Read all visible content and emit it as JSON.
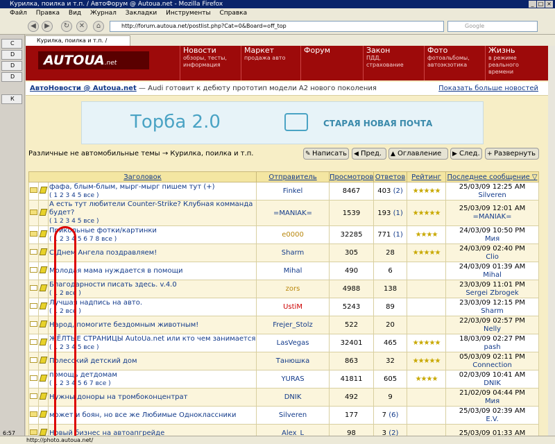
{
  "window": {
    "title": "Курилка, поилка и т.п. / АвтоФорум @ Autoua.net - Mozilla Firefox"
  },
  "menu": [
    "Файл",
    "Правка",
    "Вид",
    "Журнал",
    "Закладки",
    "Инструменты",
    "Справка"
  ],
  "url": "http://forum.autoua.net/postlist.php?Cat=0&Board=off_top",
  "search_placeholder": "Google",
  "tab_title": "Курилка, поилка и т.п. / АвтоФо...",
  "sidebar_items": [
    "C",
    "D",
    "D",
    "D",
    "К"
  ],
  "status_url": "http://photo.autoua.net/",
  "clock": "6:57",
  "logo": {
    "main": "AUTOUA",
    "suffix": ".net"
  },
  "header_nav": [
    {
      "title": "Новости",
      "sub": "обзоры, тесты, информация"
    },
    {
      "title": "Маркет",
      "sub": "продажа авто"
    },
    {
      "title": "Форум",
      "sub": ""
    },
    {
      "title": "Закон",
      "sub": "ПДД, страхование"
    },
    {
      "title": "Фото",
      "sub": "фотоальбомы, автоэкзотика"
    },
    {
      "title": "Жизнь",
      "sub": "в режиме реального времени"
    }
  ],
  "news": {
    "source": "АвтоНовости @ Autoua.net",
    "text": "— Audi готовит к дебюту прототип модели A2 нового поколения",
    "more": "Показать больше новостей"
  },
  "banner": {
    "left": "Торба 2.0",
    "right": "СТАРАЯ НОВАЯ ПОЧТА"
  },
  "breadcrumb": "Различные не автомобильные темы → Курилка, поилка и т.п.",
  "buttons": {
    "write": "Написать",
    "prev": "Пред.",
    "toc": "Оглавление",
    "next": "След.",
    "expand": "Развернуть"
  },
  "columns": [
    "Заголовок",
    "Отправитель",
    "Просмотров",
    "Ответов",
    "Рейтинг",
    "Последнее сообщение ▽"
  ],
  "rows": [
    {
      "subject": "фафа, блым-блым, мырг-мырг пишем тут (+)",
      "pages": "( 1 2 3 4 5 все )",
      "sender": "Finkel",
      "views": "8467",
      "replies": "403",
      "new": "(2)",
      "rating": "★★★★★",
      "last_date": "25/03/09 12:25 AM",
      "last_user": "Silveren"
    },
    {
      "subject": "А есть тут любители Counter-Strike? Клубная комманда будет?",
      "pages": "( 1 2 3 4 5 все )",
      "sender": "=MANIAK=",
      "views": "1539",
      "replies": "193",
      "new": "(1)",
      "rating": "★★★★★",
      "last_date": "25/03/09 12:01 AM",
      "last_user": "=MANIAK="
    },
    {
      "subject": "Прикольные фотки/картинки",
      "pages": "( 1 2 3 4 5 6 7 8 все )",
      "sender": "e0000",
      "views": "32285",
      "replies": "771",
      "new": "(1)",
      "rating": "★★★★",
      "last_date": "24/03/09 10:50 PM",
      "last_user": "Мия"
    },
    {
      "subject": "С Днем Ангела поздравляем!",
      "pages": "",
      "sender": "Sharm",
      "views": "305",
      "replies": "28",
      "new": "",
      "rating": "★★★★★",
      "last_date": "24/03/09 02:40 PM",
      "last_user": "Clio"
    },
    {
      "subject": "Молодая мама нуждается в помощи",
      "pages": "",
      "sender": "Mihal",
      "views": "490",
      "replies": "6",
      "new": "",
      "rating": "",
      "last_date": "24/03/09 01:39 AM",
      "last_user": "Mihal"
    },
    {
      "subject": "Благодарности писать здесь. v.4.0",
      "pages": "( 1 2 все )",
      "sender": "zors",
      "views": "4988",
      "replies": "138",
      "new": "",
      "rating": "",
      "last_date": "23/03/09 11:01 PM",
      "last_user": "Sergei Zbrogek"
    },
    {
      "subject": "Лучшая надпись на авто.",
      "pages": "( 1 2 все )",
      "sender": "UstiM",
      "views": "5243",
      "replies": "89",
      "new": "",
      "rating": "",
      "last_date": "23/03/09 12:15 PM",
      "last_user": "Sharm"
    },
    {
      "subject": "Народ, помогите бездомным животным!",
      "pages": "",
      "sender": "Frejer_Stolz",
      "views": "522",
      "replies": "20",
      "new": "",
      "rating": "",
      "last_date": "22/03/09 02:57 PM",
      "last_user": "Nelly"
    },
    {
      "subject": "ЖЁЛТЫЕ СТРАНИЦЫ AutoUa.net или кто чем занимается",
      "pages": "( 1 2 3 4 5 все )",
      "sender": "LasVegas",
      "views": "32401",
      "replies": "465",
      "new": "",
      "rating": "★★★★★",
      "last_date": "18/03/09 02:27 PM",
      "last_user": "pash"
    },
    {
      "subject": "Полесский детский дом",
      "pages": "",
      "sender": "Танюшка",
      "views": "863",
      "replies": "32",
      "new": "",
      "rating": "★★★★★",
      "last_date": "05/03/09 02:11 PM",
      "last_user": "Connection"
    },
    {
      "subject": "помощь детдомам",
      "pages": "( 1 2 3 4 5 6 7 все )",
      "sender": "YURAS",
      "views": "41811",
      "replies": "605",
      "new": "",
      "rating": "★★★★",
      "last_date": "02/03/09 10:41 AM",
      "last_user": "DNIK"
    },
    {
      "subject": "Нужны доноры на тромбоконцентрат",
      "pages": "",
      "sender": "DNIK",
      "views": "492",
      "replies": "9",
      "new": "",
      "rating": "",
      "last_date": "21/02/09 04:44 PM",
      "last_user": "Мия"
    },
    {
      "subject": "может и боян, но все же Любимые Одноклассники",
      "pages": "",
      "sender": "Silveren",
      "views": "177",
      "replies": "7",
      "new": "(6)",
      "rating": "",
      "last_date": "25/03/09 02:39 AM",
      "last_user": "E.V."
    },
    {
      "subject": "Новый бизнес на автоапгрейде",
      "pages": "",
      "sender": "Alex_L",
      "views": "98",
      "replies": "3",
      "new": "(2)",
      "rating": "",
      "last_date": "25/03/09 01:33 AM",
      "last_user": ""
    }
  ]
}
